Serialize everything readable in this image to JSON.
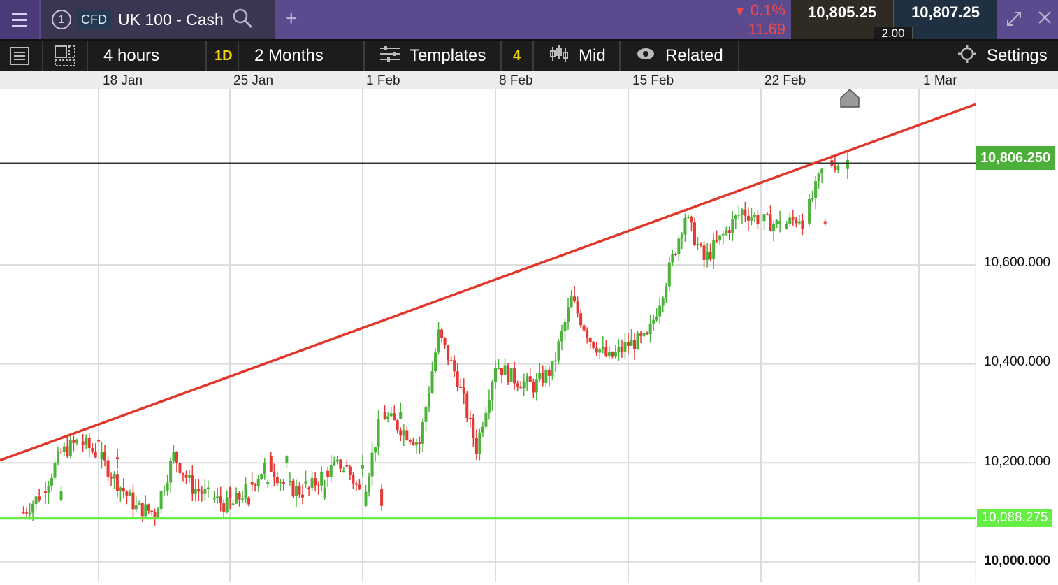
{
  "header": {
    "instrument_number": "1",
    "instrument_type": "CFD",
    "instrument_name": "UK 100 - Cash",
    "change_percent": "0.1%",
    "change_points": "11.69",
    "sell_price": "10,805.25",
    "buy_price": "10,807.25",
    "spread": "2.00",
    "add_label": "+",
    "icons": {
      "menu": "hamburger-menu-icon",
      "search": "search-icon",
      "expand": "expand-icon",
      "close": "close-icon",
      "down_arrow": "down-triangle-icon"
    }
  },
  "toolbar": {
    "interval": "4 hours",
    "range_short": "1D",
    "range": "2 Months",
    "templates": "Templates",
    "indicator_count": "4",
    "price_type": "Mid",
    "related": "Related",
    "settings": "Settings"
  },
  "colors": {
    "header_bg": "#5c4a8e",
    "trendline": "#e0372a",
    "support_line": "#66ee44",
    "candle_up": "#4cb33a",
    "candle_down": "#e53935",
    "current_price_label": "#4caf3a"
  },
  "chart_data": {
    "type": "candlestick",
    "x_tick_labels": [
      "18 Jan",
      "25 Jan",
      "1 Feb",
      "8 Feb",
      "15 Feb",
      "22 Feb",
      "1 Mar"
    ],
    "y_tick_labels": [
      "10,600.000",
      "10,400.000",
      "10,200.000",
      "10,000.000"
    ],
    "y_ticks": [
      10600,
      10400,
      10200,
      10000
    ],
    "ylim": [
      9960,
      10955
    ],
    "current_price": 10806.25,
    "current_price_label": "10,806.250",
    "support_level": 10088.275,
    "support_label": "10,088.275",
    "trendline": {
      "start": {
        "x": "2023-01-14",
        "y": 10205
      },
      "end": {
        "x": "2023-02-28",
        "y": 10925
      }
    },
    "grid": true,
    "path": [
      [
        "2023-01-14",
        10100
      ],
      [
        "2023-01-15",
        10140
      ],
      [
        "2023-01-16",
        10220
      ],
      [
        "2023-01-17",
        10245
      ],
      [
        "2023-01-18",
        10215
      ],
      [
        "2023-01-19",
        10160
      ],
      [
        "2023-01-20",
        10110
      ],
      [
        "2023-01-21",
        10100
      ],
      [
        "2023-01-22",
        10215
      ],
      [
        "2023-01-23",
        10150
      ],
      [
        "2023-01-24",
        10130
      ],
      [
        "2023-01-25",
        10110
      ],
      [
        "2023-01-26",
        10150
      ],
      [
        "2023-01-27",
        10200
      ],
      [
        "2023-01-28",
        10150
      ],
      [
        "2023-01-29",
        10140
      ],
      [
        "2023-01-30",
        10180
      ],
      [
        "2023-01-31",
        10200
      ],
      [
        "2023-02-01",
        10130
      ],
      [
        "2023-02-02",
        10300
      ],
      [
        "2023-02-03",
        10270
      ],
      [
        "2023-02-04",
        10240
      ],
      [
        "2023-02-05",
        10460
      ],
      [
        "2023-02-06",
        10370
      ],
      [
        "2023-02-07",
        10230
      ],
      [
        "2023-02-08",
        10400
      ],
      [
        "2023-02-09",
        10370
      ],
      [
        "2023-02-10",
        10355
      ],
      [
        "2023-02-11",
        10390
      ],
      [
        "2023-02-12",
        10530
      ],
      [
        "2023-02-13",
        10450
      ],
      [
        "2023-02-14",
        10410
      ],
      [
        "2023-02-15",
        10440
      ],
      [
        "2023-02-16",
        10450
      ],
      [
        "2023-02-17",
        10570
      ],
      [
        "2023-02-18",
        10700
      ],
      [
        "2023-02-19",
        10610
      ],
      [
        "2023-02-20",
        10660
      ],
      [
        "2023-02-21",
        10710
      ],
      [
        "2023-02-22",
        10690
      ],
      [
        "2023-02-23",
        10680
      ],
      [
        "2023-02-24",
        10700
      ],
      [
        "2023-02-25",
        10806
      ]
    ]
  }
}
